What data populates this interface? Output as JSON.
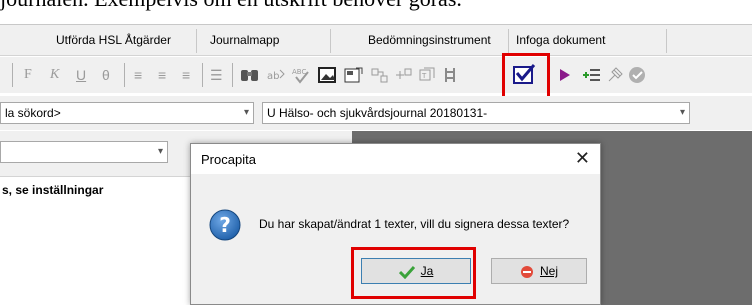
{
  "doc_text": "journalen. Exempelvis om en utskrift behöver göras.",
  "tabs": [
    "Utförda HSL Åtgärder",
    "Journalmapp",
    "Bedömningsinstrument",
    "Infoga dokument"
  ],
  "toolbar": {
    "font_glyphs": [
      "F",
      "K",
      "U",
      "θ"
    ],
    "align_glyphs": [
      "≡",
      "≡",
      "≡"
    ],
    "list_glyph": "☰"
  },
  "search_combo": {
    "value": "la sökord>"
  },
  "journal_combo": {
    "value": "U Hälso- och sjukvårdsjournal 20180131-"
  },
  "left_note": "s, se inställningar",
  "dialog": {
    "title": "Procapita",
    "close": "✕",
    "message": "Du har skapat/ändrat 1 texter, vill du signera dessa texter?",
    "yes_label": "Ja",
    "no_label": "Nej"
  },
  "colors": {
    "highlight": "#e00000",
    "dialog_bg": "#f0f0f0",
    "pane_dark": "#6d6d6d",
    "question_icon": "#1d5ea8",
    "check_icon": "#3aa33a",
    "no_icon": "#e24a3a"
  }
}
